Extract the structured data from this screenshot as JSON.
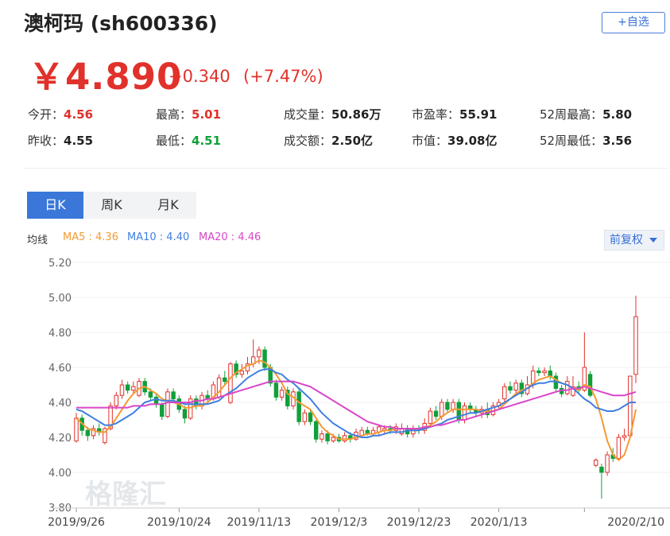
{
  "header": {
    "title": "澳柯玛 (sh600336)",
    "add_watch_label": "+自选"
  },
  "quote": {
    "price": "￥4.890",
    "change": "+0.340",
    "change_pct": "(+7.47%)"
  },
  "stats": [
    {
      "label": "今开：",
      "value": "4.56",
      "tone": "red"
    },
    {
      "label": "最高：",
      "value": "5.01",
      "tone": "red"
    },
    {
      "label": "成交量：",
      "value": "50.86万",
      "tone": "dark"
    },
    {
      "label": "市盈率：",
      "value": "55.91",
      "tone": "dark"
    },
    {
      "label": "52周最高：",
      "value": "5.80",
      "tone": "dark"
    },
    {
      "label": "昨收：",
      "value": "4.55",
      "tone": "dark"
    },
    {
      "label": "最低：",
      "value": "4.51",
      "tone": "green"
    },
    {
      "label": "成交额：",
      "value": "2.50亿",
      "tone": "dark"
    },
    {
      "label": "市值：",
      "value": "39.08亿",
      "tone": "dark"
    },
    {
      "label": "52周最低：",
      "value": "3.56",
      "tone": "dark"
    }
  ],
  "tabs": [
    "日K",
    "周K",
    "月K"
  ],
  "active_tab": 0,
  "ma_legend": {
    "label": "均线",
    "ma5": "MA5 : 4.36",
    "ma10": "MA10 : 4.40",
    "ma20": "MA20 : 4.46"
  },
  "adjust_label": "前复权",
  "watermark": "格隆汇",
  "colors": {
    "up": "#e1312b",
    "down": "#119f3a",
    "ma5": "#f39a33",
    "ma10": "#3f7fe0",
    "ma20": "#d946c8",
    "accent": "#3a77d9"
  },
  "chart_data": {
    "type": "candlestick",
    "ylim": [
      3.8,
      5.2
    ],
    "y_ticks": [
      "5.20",
      "5.00",
      "4.80",
      "4.60",
      "4.40",
      "4.20",
      "4.00",
      "3.80"
    ],
    "x_ticks": [
      "2019/9/26",
      "2019/10/24",
      "2019/11/13",
      "2019/12/3",
      "2019/12/23",
      "2020/1/13",
      "2020/2/10"
    ],
    "x_tick_index": [
      0,
      18,
      32,
      46,
      60,
      74,
      89
    ],
    "candles": [
      [
        4.18,
        4.31,
        4.34,
        4.17
      ],
      [
        4.31,
        4.24,
        4.33,
        4.21
      ],
      [
        4.24,
        4.21,
        4.26,
        4.18
      ],
      [
        4.21,
        4.25,
        4.27,
        4.19
      ],
      [
        4.25,
        4.23,
        4.28,
        4.21
      ],
      [
        4.17,
        4.25,
        4.26,
        4.16
      ],
      [
        4.25,
        4.38,
        4.4,
        4.24
      ],
      [
        4.38,
        4.44,
        4.46,
        4.36
      ],
      [
        4.44,
        4.5,
        4.53,
        4.42
      ],
      [
        4.5,
        4.47,
        4.52,
        4.45
      ],
      [
        4.47,
        4.49,
        4.52,
        4.45
      ],
      [
        4.44,
        4.52,
        4.54,
        4.43
      ],
      [
        4.52,
        4.46,
        4.54,
        4.44
      ],
      [
        4.46,
        4.43,
        4.48,
        4.41
      ],
      [
        4.43,
        4.39,
        4.45,
        4.37
      ],
      [
        4.39,
        4.32,
        4.4,
        4.3
      ],
      [
        4.32,
        4.46,
        4.48,
        4.31
      ],
      [
        4.46,
        4.42,
        4.48,
        4.4
      ],
      [
        4.42,
        4.36,
        4.44,
        4.34
      ],
      [
        4.36,
        4.31,
        4.38,
        4.28
      ],
      [
        4.31,
        4.42,
        4.44,
        4.3
      ],
      [
        4.42,
        4.38,
        4.44,
        4.36
      ],
      [
        4.38,
        4.44,
        4.46,
        4.36
      ],
      [
        4.44,
        4.42,
        4.47,
        4.4
      ],
      [
        4.42,
        4.5,
        4.52,
        4.41
      ],
      [
        4.43,
        4.54,
        4.56,
        4.42
      ],
      [
        4.54,
        4.52,
        4.58,
        4.5
      ],
      [
        4.4,
        4.62,
        4.63,
        4.39
      ],
      [
        4.62,
        4.56,
        4.64,
        4.54
      ],
      [
        4.56,
        4.58,
        4.62,
        4.54
      ],
      [
        4.58,
        4.62,
        4.66,
        4.56
      ],
      [
        4.62,
        4.66,
        4.76,
        4.6
      ],
      [
        4.66,
        4.7,
        4.72,
        4.62
      ],
      [
        4.7,
        4.6,
        4.72,
        4.58
      ],
      [
        4.6,
        4.51,
        4.62,
        4.49
      ],
      [
        4.51,
        4.43,
        4.53,
        4.41
      ],
      [
        4.43,
        4.47,
        4.49,
        4.41
      ],
      [
        4.47,
        4.38,
        4.49,
        4.36
      ],
      [
        4.38,
        4.46,
        4.48,
        4.36
      ],
      [
        4.46,
        4.29,
        4.48,
        4.27
      ],
      [
        4.29,
        4.34,
        4.36,
        4.27
      ],
      [
        4.34,
        4.29,
        4.36,
        4.27
      ],
      [
        4.29,
        4.19,
        4.3,
        4.17
      ],
      [
        4.19,
        4.22,
        4.24,
        4.17
      ],
      [
        4.22,
        4.18,
        4.24,
        4.16
      ],
      [
        4.18,
        4.2,
        4.22,
        4.17
      ],
      [
        4.2,
        4.18,
        4.22,
        4.17
      ],
      [
        4.18,
        4.21,
        4.23,
        4.17
      ],
      [
        4.21,
        4.19,
        4.23,
        4.17
      ],
      [
        4.19,
        4.23,
        4.25,
        4.18
      ],
      [
        4.21,
        4.24,
        4.26,
        4.2
      ],
      [
        4.24,
        4.22,
        4.26,
        4.21
      ],
      [
        4.22,
        4.24,
        4.26,
        4.21
      ],
      [
        4.23,
        4.26,
        4.27,
        4.21
      ],
      [
        4.24,
        4.25,
        4.27,
        4.22
      ],
      [
        4.25,
        4.24,
        4.27,
        4.22
      ],
      [
        4.24,
        4.26,
        4.28,
        4.22
      ],
      [
        4.22,
        4.25,
        4.28,
        4.21
      ],
      [
        4.25,
        4.22,
        4.27,
        4.2
      ],
      [
        4.22,
        4.25,
        4.27,
        4.2
      ],
      [
        4.25,
        4.24,
        4.27,
        4.22
      ],
      [
        4.24,
        4.28,
        4.31,
        4.22
      ],
      [
        4.28,
        4.35,
        4.37,
        4.26
      ],
      [
        4.35,
        4.32,
        4.38,
        4.3
      ],
      [
        4.32,
        4.4,
        4.42,
        4.3
      ],
      [
        4.4,
        4.36,
        4.42,
        4.34
      ],
      [
        4.36,
        4.4,
        4.42,
        4.34
      ],
      [
        4.4,
        4.3,
        4.42,
        4.28
      ],
      [
        4.3,
        4.38,
        4.4,
        4.28
      ],
      [
        4.38,
        4.36,
        4.4,
        4.34
      ],
      [
        4.36,
        4.34,
        4.38,
        4.32
      ],
      [
        4.34,
        4.36,
        4.38,
        4.31
      ],
      [
        4.36,
        4.33,
        4.4,
        4.31
      ],
      [
        4.33,
        4.38,
        4.4,
        4.32
      ],
      [
        4.38,
        4.4,
        4.42,
        4.36
      ],
      [
        4.42,
        4.49,
        4.51,
        4.4
      ],
      [
        4.49,
        4.47,
        4.52,
        4.45
      ],
      [
        4.47,
        4.51,
        4.53,
        4.45
      ],
      [
        4.51,
        4.45,
        4.53,
        4.43
      ],
      [
        4.45,
        4.5,
        4.55,
        4.44
      ],
      [
        4.5,
        4.58,
        4.61,
        4.48
      ],
      [
        4.58,
        4.57,
        4.6,
        4.55
      ],
      [
        4.57,
        4.58,
        4.6,
        4.55
      ],
      [
        4.58,
        4.55,
        4.61,
        4.53
      ],
      [
        4.55,
        4.48,
        4.57,
        4.46
      ],
      [
        4.48,
        4.45,
        4.5,
        4.43
      ],
      [
        4.45,
        4.52,
        4.55,
        4.44
      ],
      [
        4.44,
        4.49,
        4.55,
        4.43
      ],
      [
        4.49,
        4.47,
        4.52,
        4.45
      ],
      [
        4.47,
        4.6,
        4.8,
        4.46
      ],
      [
        4.56,
        4.44,
        4.58,
        4.43
      ],
      [
        4.04,
        4.07,
        4.08,
        4.03
      ],
      [
        4.03,
        4.0,
        4.05,
        3.85
      ],
      [
        4.0,
        4.1,
        4.12,
        3.98
      ],
      [
        4.1,
        4.08,
        4.14,
        4.06
      ],
      [
        4.08,
        4.2,
        4.22,
        4.07
      ],
      [
        4.2,
        4.21,
        4.25,
        4.18
      ],
      [
        4.21,
        4.55,
        4.55,
        4.2
      ],
      [
        4.56,
        4.89,
        5.01,
        4.51
      ]
    ],
    "series": [
      {
        "name": "MA5",
        "values": [
          4.31,
          4.28,
          4.25,
          4.24,
          4.23,
          4.23,
          4.26,
          4.31,
          4.36,
          4.41,
          4.45,
          4.48,
          4.49,
          4.47,
          4.45,
          4.42,
          4.41,
          4.4,
          4.39,
          4.37,
          4.37,
          4.38,
          4.38,
          4.4,
          4.43,
          4.46,
          4.5,
          4.54,
          4.57,
          4.59,
          4.61,
          4.62,
          4.64,
          4.63,
          4.6,
          4.56,
          4.51,
          4.45,
          4.43,
          4.4,
          4.38,
          4.36,
          4.31,
          4.26,
          4.23,
          4.21,
          4.19,
          4.19,
          4.19,
          4.2,
          4.21,
          4.22,
          4.22,
          4.23,
          4.24,
          4.24,
          4.25,
          4.25,
          4.25,
          4.24,
          4.24,
          4.25,
          4.27,
          4.29,
          4.32,
          4.34,
          4.36,
          4.36,
          4.36,
          4.36,
          4.36,
          4.35,
          4.35,
          4.35,
          4.36,
          4.39,
          4.42,
          4.45,
          4.47,
          4.48,
          4.51,
          4.53,
          4.54,
          4.55,
          4.53,
          4.51,
          4.5,
          4.48,
          4.47,
          4.5,
          4.49,
          4.42,
          4.31,
          4.18,
          4.1,
          4.07,
          4.1,
          4.2,
          4.36
        ]
      },
      {
        "name": "MA10",
        "values": [
          4.36,
          4.35,
          4.33,
          4.31,
          4.29,
          4.27,
          4.27,
          4.28,
          4.3,
          4.32,
          4.34,
          4.37,
          4.4,
          4.41,
          4.42,
          4.41,
          4.41,
          4.41,
          4.4,
          4.39,
          4.39,
          4.39,
          4.39,
          4.39,
          4.4,
          4.41,
          4.44,
          4.46,
          4.48,
          4.51,
          4.54,
          4.56,
          4.58,
          4.59,
          4.59,
          4.57,
          4.56,
          4.53,
          4.51,
          4.48,
          4.45,
          4.42,
          4.38,
          4.34,
          4.31,
          4.28,
          4.26,
          4.24,
          4.22,
          4.21,
          4.2,
          4.2,
          4.21,
          4.21,
          4.22,
          4.23,
          4.23,
          4.23,
          4.24,
          4.24,
          4.24,
          4.25,
          4.26,
          4.27,
          4.28,
          4.3,
          4.31,
          4.32,
          4.33,
          4.34,
          4.34,
          4.35,
          4.36,
          4.37,
          4.38,
          4.4,
          4.42,
          4.44,
          4.46,
          4.48,
          4.5,
          4.51,
          4.51,
          4.52,
          4.52,
          4.51,
          4.5,
          4.48,
          4.45,
          4.42,
          4.4,
          4.37,
          4.36,
          4.35,
          4.35,
          4.36,
          4.38,
          4.4,
          4.4
        ]
      },
      {
        "name": "MA20",
        "values": [
          4.37,
          4.37,
          4.37,
          4.37,
          4.37,
          4.37,
          4.37,
          4.37,
          4.37,
          4.37,
          4.38,
          4.38,
          4.38,
          4.39,
          4.39,
          4.39,
          4.4,
          4.4,
          4.4,
          4.4,
          4.4,
          4.41,
          4.41,
          4.42,
          4.42,
          4.43,
          4.44,
          4.45,
          4.46,
          4.47,
          4.48,
          4.49,
          4.5,
          4.51,
          4.52,
          4.52,
          4.52,
          4.52,
          4.52,
          4.51,
          4.5,
          4.49,
          4.47,
          4.45,
          4.43,
          4.41,
          4.39,
          4.37,
          4.35,
          4.33,
          4.31,
          4.29,
          4.28,
          4.27,
          4.26,
          4.26,
          4.25,
          4.25,
          4.25,
          4.25,
          4.25,
          4.26,
          4.26,
          4.27,
          4.27,
          4.28,
          4.29,
          4.3,
          4.3,
          4.31,
          4.32,
          4.33,
          4.34,
          4.35,
          4.36,
          4.37,
          4.38,
          4.39,
          4.4,
          4.41,
          4.42,
          4.43,
          4.44,
          4.45,
          4.46,
          4.47,
          4.47,
          4.48,
          4.48,
          4.49,
          4.48,
          4.47,
          4.46,
          4.45,
          4.44,
          4.44,
          4.44,
          4.45,
          4.46
        ]
      }
    ]
  }
}
